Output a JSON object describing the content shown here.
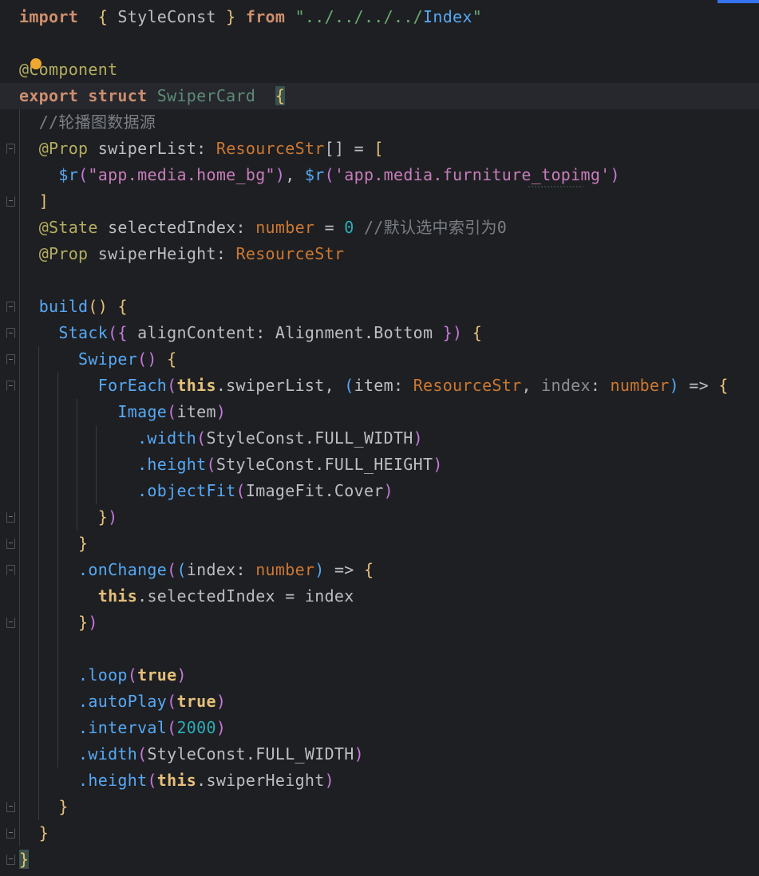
{
  "editor": {
    "lines": [
      [
        [
          "tok-kwb",
          "import"
        ],
        [
          "",
          "  "
        ],
        [
          "b1",
          "{"
        ],
        [
          "tok-prop",
          " StyleConst "
        ],
        [
          "b1",
          "}"
        ],
        [
          "tok-kwb",
          " from"
        ],
        [
          "tok-str",
          " \""
        ],
        [
          "tok-str",
          "../../../../"
        ],
        [
          "tok-path",
          "Index"
        ],
        [
          "tok-str",
          "\""
        ]
      ],
      [],
      [
        [
          "tok-deco",
          "@Component"
        ]
      ],
      [
        [
          "tok-kwb",
          "export"
        ],
        [
          "tok-kwb",
          " struct"
        ],
        [
          "tok-class",
          " SwiperCard"
        ],
        [
          "",
          "  "
        ],
        [
          "brace-match",
          "{"
        ]
      ],
      [
        [
          "",
          "  "
        ],
        [
          "tok-cmt",
          "//轮播图数据源"
        ]
      ],
      [
        [
          "",
          "  "
        ],
        [
          "tok-deco",
          "@Prop"
        ],
        [
          "tok-prop",
          " swiperList"
        ],
        [
          "tok-pn",
          ": "
        ],
        [
          "tok-type",
          "ResourceStr"
        ],
        [
          "tok-pn",
          "[] = "
        ],
        [
          "b1",
          "["
        ]
      ],
      [
        [
          "",
          "    "
        ],
        [
          "tok-fn",
          "$r"
        ],
        [
          "b2",
          "("
        ],
        [
          "tok-str2",
          "\"app.media.home_bg\""
        ],
        [
          "b2",
          ")"
        ],
        [
          "tok-pn",
          ", "
        ],
        [
          "tok-fn",
          "$r"
        ],
        [
          "b2",
          "("
        ],
        [
          "tok-str2",
          "'app.media.furniture_topimg'"
        ],
        [
          "b2",
          ")"
        ]
      ],
      [
        [
          "",
          "  "
        ],
        [
          "b1",
          "]"
        ]
      ],
      [
        [
          "",
          "  "
        ],
        [
          "tok-deco",
          "@State"
        ],
        [
          "tok-prop",
          " selectedIndex"
        ],
        [
          "tok-pn",
          ": "
        ],
        [
          "tok-type",
          "number"
        ],
        [
          "tok-pn",
          " = "
        ],
        [
          "tok-num",
          "0"
        ],
        [
          "tok-cmt",
          " //默认选中索引为0"
        ]
      ],
      [
        [
          "",
          "  "
        ],
        [
          "tok-deco",
          "@Prop"
        ],
        [
          "tok-prop",
          " swiperHeight"
        ],
        [
          "tok-pn",
          ": "
        ],
        [
          "tok-type",
          "ResourceStr"
        ]
      ],
      [],
      [
        [
          "",
          "  "
        ],
        [
          "tok-fn",
          "build"
        ],
        [
          "b1",
          "()"
        ],
        [
          "tok-pn",
          " "
        ],
        [
          "b1",
          "{"
        ]
      ],
      [
        [
          "",
          "    "
        ],
        [
          "tok-fn",
          "Stack"
        ],
        [
          "b2",
          "({"
        ],
        [
          "tok-prop",
          " alignContent"
        ],
        [
          "tok-pn",
          ": Alignment.Bottom "
        ],
        [
          "b2",
          "})"
        ],
        [
          "tok-pn",
          " "
        ],
        [
          "b1",
          "{"
        ]
      ],
      [
        [
          "",
          "      "
        ],
        [
          "tok-fn",
          "Swiper"
        ],
        [
          "b2",
          "()"
        ],
        [
          "tok-pn",
          " "
        ],
        [
          "b1",
          "{"
        ]
      ],
      [
        [
          "",
          "        "
        ],
        [
          "tok-fn",
          "ForEach"
        ],
        [
          "b2",
          "("
        ],
        [
          "tok-this",
          "this"
        ],
        [
          "tok-pn",
          ".swiperList, "
        ],
        [
          "b3",
          "("
        ],
        [
          "tok-prop",
          "item"
        ],
        [
          "tok-pn",
          ": "
        ],
        [
          "tok-type",
          "ResourceStr"
        ],
        [
          "tok-pn",
          ", "
        ],
        [
          "tok-param",
          "index"
        ],
        [
          "tok-pn",
          ": "
        ],
        [
          "tok-type",
          "number"
        ],
        [
          "b3",
          ")"
        ],
        [
          "tok-pn",
          " => "
        ],
        [
          "b1",
          "{"
        ]
      ],
      [
        [
          "",
          "          "
        ],
        [
          "tok-fn",
          "Image"
        ],
        [
          "b2",
          "("
        ],
        [
          "tok-prop",
          "item"
        ],
        [
          "b2",
          ")"
        ]
      ],
      [
        [
          "",
          "            "
        ],
        [
          "tok-fn",
          ".width"
        ],
        [
          "b2",
          "("
        ],
        [
          "tok-prop",
          "StyleConst.FULL_WIDTH"
        ],
        [
          "b2",
          ")"
        ]
      ],
      [
        [
          "",
          "            "
        ],
        [
          "tok-fn",
          ".height"
        ],
        [
          "b2",
          "("
        ],
        [
          "tok-prop",
          "StyleConst.FULL_HEIGHT"
        ],
        [
          "b2",
          ")"
        ]
      ],
      [
        [
          "",
          "            "
        ],
        [
          "tok-fn",
          ".objectFit"
        ],
        [
          "b2",
          "("
        ],
        [
          "tok-prop",
          "ImageFit.Cover"
        ],
        [
          "b2",
          ")"
        ]
      ],
      [
        [
          "",
          "        "
        ],
        [
          "b1",
          "}"
        ],
        [
          "b2",
          ")"
        ]
      ],
      [
        [
          "",
          "      "
        ],
        [
          "b1",
          "}"
        ]
      ],
      [
        [
          "",
          "      "
        ],
        [
          "tok-fn",
          ".onChange"
        ],
        [
          "b2",
          "("
        ],
        [
          "b3",
          "("
        ],
        [
          "tok-prop",
          "index"
        ],
        [
          "tok-pn",
          ": "
        ],
        [
          "tok-type",
          "number"
        ],
        [
          "b3",
          ")"
        ],
        [
          "tok-pn",
          " => "
        ],
        [
          "b1",
          "{"
        ]
      ],
      [
        [
          "",
          "        "
        ],
        [
          "tok-this",
          "this"
        ],
        [
          "tok-pn",
          ".selectedIndex = index"
        ]
      ],
      [
        [
          "",
          "      "
        ],
        [
          "b1",
          "}"
        ],
        [
          "b2",
          ")"
        ]
      ],
      [],
      [
        [
          "",
          "      "
        ],
        [
          "tok-fn",
          ".loop"
        ],
        [
          "b2",
          "("
        ],
        [
          "tok-this",
          "true"
        ],
        [
          "b2",
          ")"
        ]
      ],
      [
        [
          "",
          "      "
        ],
        [
          "tok-fn",
          ".autoPlay"
        ],
        [
          "b2",
          "("
        ],
        [
          "tok-this",
          "true"
        ],
        [
          "b2",
          ")"
        ]
      ],
      [
        [
          "",
          "      "
        ],
        [
          "tok-fn",
          ".interval"
        ],
        [
          "b2",
          "("
        ],
        [
          "tok-num",
          "2000"
        ],
        [
          "b2",
          ")"
        ]
      ],
      [
        [
          "",
          "      "
        ],
        [
          "tok-fn",
          ".width"
        ],
        [
          "b2",
          "("
        ],
        [
          "tok-prop",
          "StyleConst.FULL_WIDTH"
        ],
        [
          "b2",
          ")"
        ]
      ],
      [
        [
          "",
          "      "
        ],
        [
          "tok-fn",
          ".height"
        ],
        [
          "b2",
          "("
        ],
        [
          "tok-this",
          "this"
        ],
        [
          "tok-pn",
          ".swiperHeight"
        ],
        [
          "b2",
          ")"
        ]
      ],
      [
        [
          "",
          "    "
        ],
        [
          "b1",
          "}"
        ]
      ],
      [
        [
          "",
          "  "
        ],
        [
          "b1",
          "}"
        ]
      ],
      [
        [
          "brace-match",
          "}"
        ]
      ]
    ],
    "highlighted_line": 4,
    "warning_line": 3
  },
  "colors": {
    "background": "#1e1f22",
    "keyword": "#cf8e6d",
    "string": "#6aab73",
    "function": "#56a8f5",
    "number": "#2aacb8",
    "comment": "#7a7e85",
    "decorator": "#b3ae60"
  }
}
